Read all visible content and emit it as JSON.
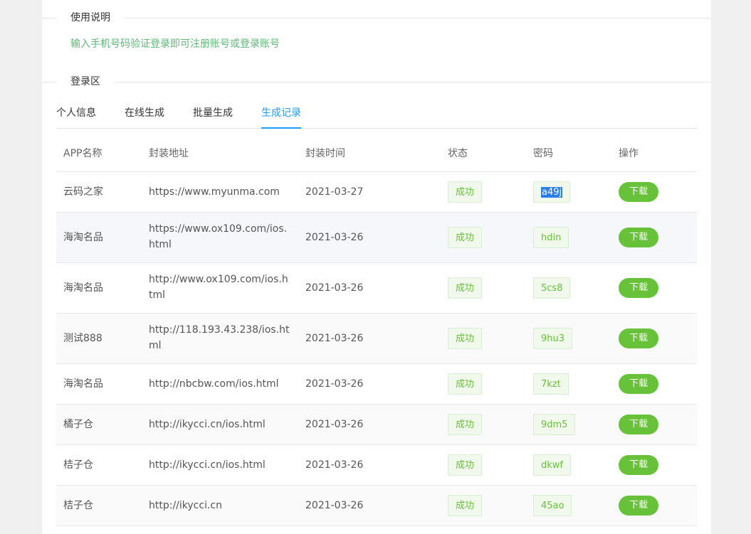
{
  "sections": {
    "usage_title": "使用说明",
    "usage_text": "输入手机号码验证登录即可注册账号或登录账号",
    "login_title": "登录区"
  },
  "tabs": [
    {
      "label": "个人信息",
      "active": false
    },
    {
      "label": "在线生成",
      "active": false
    },
    {
      "label": "批量生成",
      "active": false
    },
    {
      "label": "生成记录",
      "active": true
    }
  ],
  "table": {
    "headers": [
      "APP名称",
      "封装地址",
      "封装时间",
      "状态",
      "密码",
      "操作"
    ],
    "rows": [
      {
        "app": "云码之家",
        "url": "https://www.myunma.com",
        "date": "2021-03-27",
        "status": "成功",
        "password": "a49j",
        "action": "下载"
      },
      {
        "app": "海淘名品",
        "url": "https://www.ox109.com/ios.html",
        "date": "2021-03-26",
        "status": "成功",
        "password": "hdin",
        "action": "下载"
      },
      {
        "app": "海淘名品",
        "url": "http://www.ox109.com/ios.html",
        "date": "2021-03-26",
        "status": "成功",
        "password": "5cs8",
        "action": "下载"
      },
      {
        "app": "测试888",
        "url": "http://118.193.43.238/ios.html",
        "date": "2021-03-26",
        "status": "成功",
        "password": "9hu3",
        "action": "下载"
      },
      {
        "app": "海淘名品",
        "url": "http://nbcbw.com/ios.html",
        "date": "2021-03-26",
        "status": "成功",
        "password": "7kzt",
        "action": "下载"
      },
      {
        "app": "橘子仓",
        "url": "http://ikycci.cn/ios.html",
        "date": "2021-03-26",
        "status": "成功",
        "password": "9dm5",
        "action": "下载"
      },
      {
        "app": "桔子仓",
        "url": "http://ikycci.cn/ios.html",
        "date": "2021-03-26",
        "status": "成功",
        "password": "dkwf",
        "action": "下载"
      },
      {
        "app": "桔子仓",
        "url": "http://ikycci.cn",
        "date": "2021-03-26",
        "status": "成功",
        "password": "45ao",
        "action": "下载"
      }
    ]
  },
  "colors": {
    "accent": "#1e9fff",
    "success": "#67c23a",
    "instruction": "#5fb878"
  }
}
